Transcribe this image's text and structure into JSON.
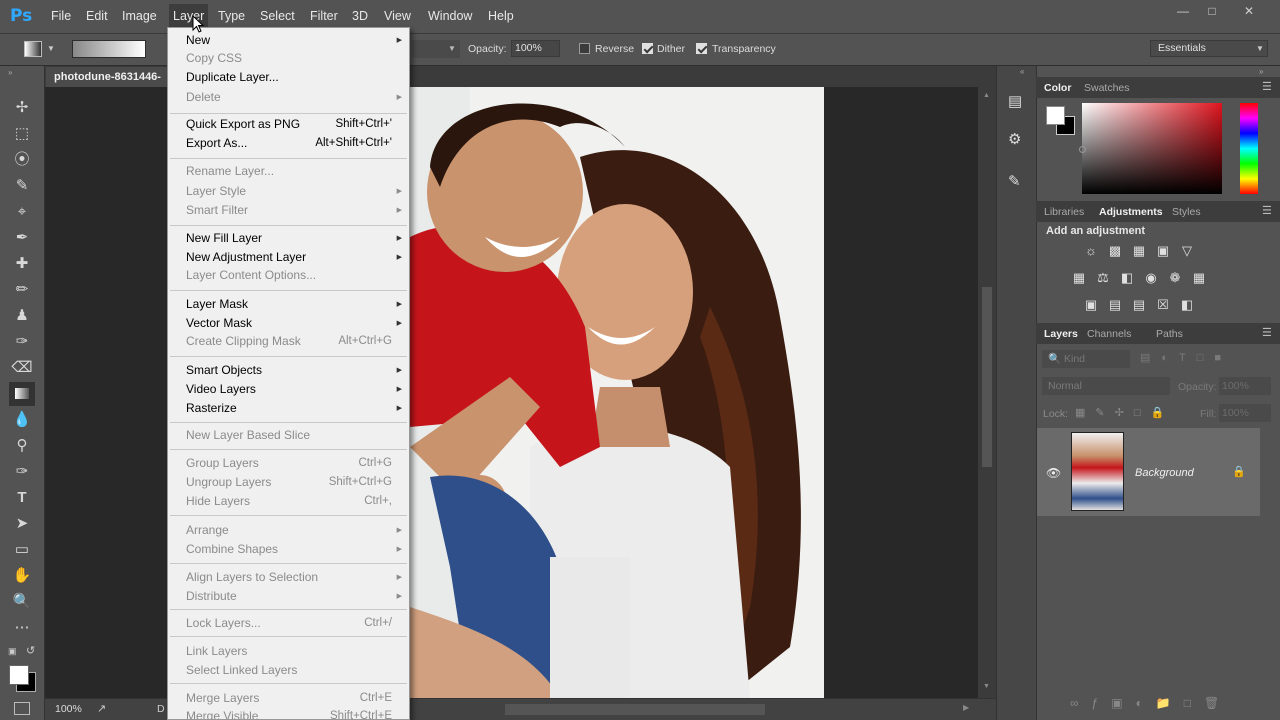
{
  "menubar": {
    "logo": "Ps",
    "items": [
      "File",
      "Edit",
      "Image",
      "Layer",
      "Type",
      "Select",
      "Filter",
      "3D",
      "View",
      "Window",
      "Help"
    ]
  },
  "options": {
    "opacity_label": "Opacity:",
    "opacity_value": "100%",
    "reverse_label": "Reverse",
    "dither_label": "Dither",
    "transparency_label": "Transparency",
    "workspace": "Essentials"
  },
  "document": {
    "tab_title": "photodune-8631446-"
  },
  "status": {
    "zoom": "100%",
    "doc_prefix": "D"
  },
  "color_panel": {
    "tabs": [
      "Color",
      "Swatches"
    ]
  },
  "adjust_panel": {
    "tabs": [
      "Libraries",
      "Adjustments",
      "Styles"
    ],
    "heading": "Add an adjustment"
  },
  "layers_panel": {
    "tabs": [
      "Layers",
      "Channels",
      "Paths"
    ],
    "kind_label": "Kind",
    "blend_mode": "Normal",
    "opacity_label": "Opacity:",
    "opacity_value": "100%",
    "lock_label": "Lock:",
    "fill_label": "Fill:",
    "fill_value": "100%",
    "layer_name": "Background"
  },
  "layer_menu": {
    "new": "New",
    "copy_css": "Copy CSS",
    "duplicate": "Duplicate Layer...",
    "delete": "Delete",
    "quick_export": "Quick Export as PNG",
    "quick_export_sc": "Shift+Ctrl+'",
    "export_as": "Export As...",
    "export_as_sc": "Alt+Shift+Ctrl+'",
    "rename": "Rename Layer...",
    "layer_style": "Layer Style",
    "smart_filter": "Smart Filter",
    "new_fill": "New Fill Layer",
    "new_adjustment": "New Adjustment Layer",
    "content_options": "Layer Content Options...",
    "layer_mask": "Layer Mask",
    "vector_mask": "Vector Mask",
    "clipping_mask": "Create Clipping Mask",
    "clipping_mask_sc": "Alt+Ctrl+G",
    "smart_objects": "Smart Objects",
    "video_layers": "Video Layers",
    "rasterize": "Rasterize",
    "new_slice": "New Layer Based Slice",
    "group": "Group Layers",
    "group_sc": "Ctrl+G",
    "ungroup": "Ungroup Layers",
    "ungroup_sc": "Shift+Ctrl+G",
    "hide": "Hide Layers",
    "hide_sc": "Ctrl+,",
    "arrange": "Arrange",
    "combine": "Combine Shapes",
    "align": "Align Layers to Selection",
    "distribute": "Distribute",
    "lock": "Lock Layers...",
    "lock_sc": "Ctrl+/",
    "link": "Link Layers",
    "select_linked": "Select Linked Layers",
    "merge": "Merge Layers",
    "merge_sc": "Ctrl+E",
    "merge_visible": "Merge Visible",
    "merge_visible_sc": "Shift+Ctrl+E"
  }
}
